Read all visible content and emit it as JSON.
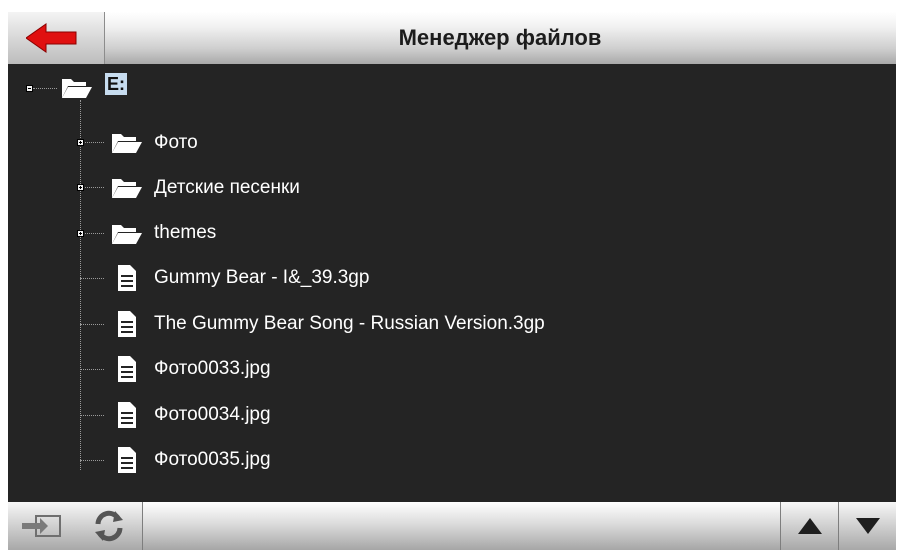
{
  "header": {
    "title": "Менеджер файлов",
    "back_icon": "arrow-left-icon",
    "back_color": "#e01010"
  },
  "tree": {
    "root": {
      "label": "E:",
      "expanded": true,
      "icon": "folder-open-icon"
    },
    "items": [
      {
        "label": "Фото",
        "type": "folder",
        "expandable": true,
        "icon": "folder-open-icon"
      },
      {
        "label": "Детские песенки",
        "type": "folder",
        "expandable": true,
        "icon": "folder-open-icon"
      },
      {
        "label": "themes",
        "type": "folder",
        "expandable": true,
        "icon": "folder-open-icon"
      },
      {
        "label": "Gummy Bear - I&_39.3gp",
        "type": "file",
        "expandable": false,
        "icon": "document-icon"
      },
      {
        "label": "The Gummy Bear Song - Russian Version.3gp",
        "type": "file",
        "expandable": false,
        "icon": "document-icon"
      },
      {
        "label": "Фото0033.jpg",
        "type": "file",
        "expandable": false,
        "icon": "document-icon"
      },
      {
        "label": "Фото0034.jpg",
        "type": "file",
        "expandable": false,
        "icon": "document-icon"
      },
      {
        "label": "Фото0035.jpg",
        "type": "file",
        "expandable": false,
        "icon": "document-icon"
      }
    ]
  },
  "toolbar": {
    "buttons": [
      "exit-icon",
      "refresh-icon",
      "scroll-up-icon",
      "scroll-down-icon"
    ]
  }
}
